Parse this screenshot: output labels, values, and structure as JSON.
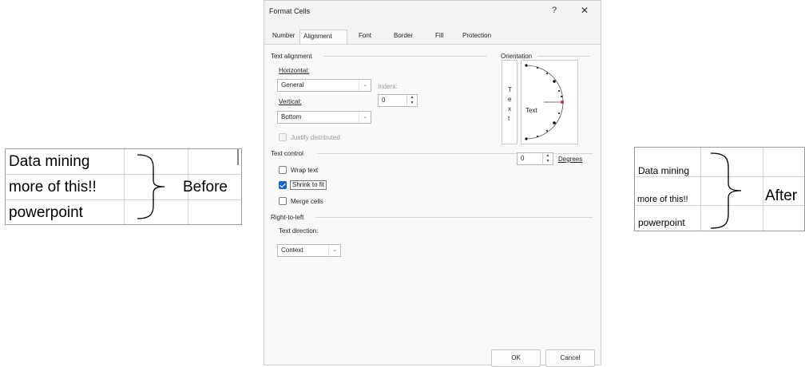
{
  "before": {
    "cells": [
      "Data mining",
      "more of this!!",
      "powerpoint"
    ],
    "callout": "Before"
  },
  "after": {
    "cells": [
      "Data mining",
      "more of this!!",
      "powerpoint"
    ],
    "callout": "After"
  },
  "dialog": {
    "title": "Format Cells",
    "help": "?",
    "close": "✕",
    "tabs": [
      "Number",
      "Alignment",
      "Font",
      "Border",
      "Fill",
      "Protection"
    ],
    "active_tab": "Alignment",
    "text_alignment": {
      "section": "Text alignment",
      "horizontal_label": "Horizontal:",
      "horizontal_value": "General",
      "indent_label": "Indent:",
      "indent_value": "0",
      "vertical_label": "Vertical:",
      "vertical_value": "Bottom",
      "justify_label": "Justify distributed",
      "justify_checked": false
    },
    "text_control": {
      "section": "Text control",
      "wrap_label": "Wrap text",
      "wrap_checked": false,
      "shrink_label": "Shrink to fit",
      "shrink_checked": true,
      "merge_label": "Merge cells",
      "merge_checked": false
    },
    "rtl": {
      "section": "Right-to-left",
      "direction_label": "Text direction:",
      "direction_value": "Context"
    },
    "orientation": {
      "section": "Orientation",
      "vertical_letters": [
        "T",
        "e",
        "x",
        "t"
      ],
      "arc_text": "Text",
      "degrees_value": "0",
      "degrees_label": "Degrees",
      "accent_color": "#c0392b"
    },
    "ok_label": "OK",
    "cancel_label": "Cancel"
  }
}
